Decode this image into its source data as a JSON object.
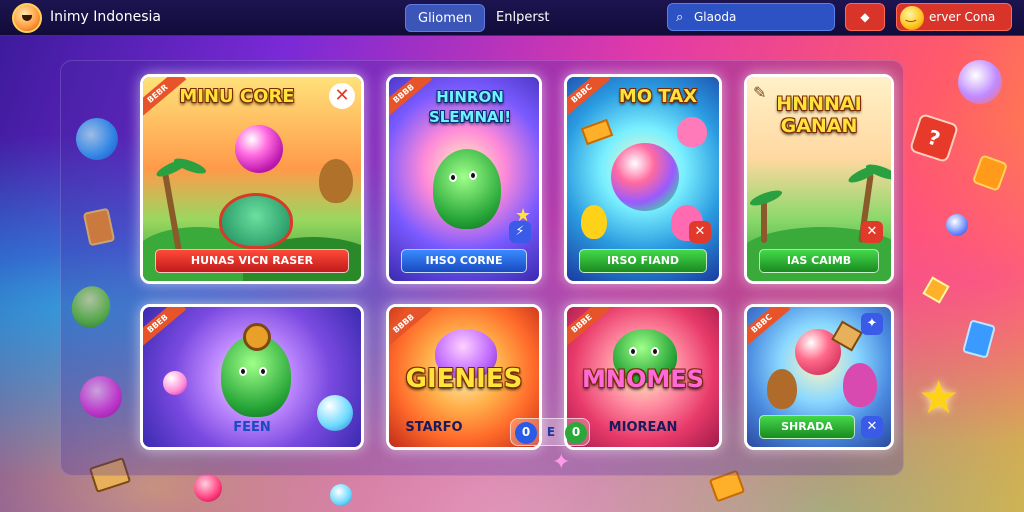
{
  "topbar": {
    "brand": "Inimy Indonesia",
    "tabs": [
      {
        "label": "Gliomen",
        "active": true
      },
      {
        "label": "Enlperst",
        "active": false
      }
    ],
    "search": {
      "placeholder": "Glaoda"
    },
    "user_button": "erver Cona"
  },
  "cards": [
    {
      "ribbon": "BEBR",
      "title": "MINU CORE",
      "button": "HUNAS VICN RASER",
      "button_color": "red"
    },
    {
      "ribbon": "BBBB",
      "title": "HINRON SLEMNAI!",
      "button": "IHSO CORNE",
      "button_color": "blue"
    },
    {
      "ribbon": "BBBC",
      "title": "MO TAX",
      "button": "IRSO FIAND",
      "button_color": "green"
    },
    {
      "ribbon": "",
      "title": "HNNNAI GANAN",
      "button": "IAS CAIMB",
      "button_color": "green"
    },
    {
      "ribbon": "BBEB",
      "title": "",
      "button": "FEEN",
      "button_color": "none"
    },
    {
      "ribbon": "BBBB",
      "title": "GIENIES",
      "button": "STARFO",
      "button_color": "none"
    },
    {
      "ribbon": "BBBE",
      "title": "MNOMES",
      "button": "MIOREAN",
      "button_color": "none"
    },
    {
      "ribbon": "BBBC",
      "title": "",
      "button": "SHRADA",
      "button_color": "green"
    }
  ],
  "pager": [
    "0",
    "E",
    "0"
  ],
  "colors": {
    "topbar": "#120c3a",
    "active_tab": "#3b56b8",
    "search": "#2c52c4",
    "danger_button": "#d8342a",
    "title_yellow": "#ffe23a",
    "button_red": "#c01a1a",
    "button_blue": "#1a4ac0",
    "button_green": "#1a8a20"
  }
}
